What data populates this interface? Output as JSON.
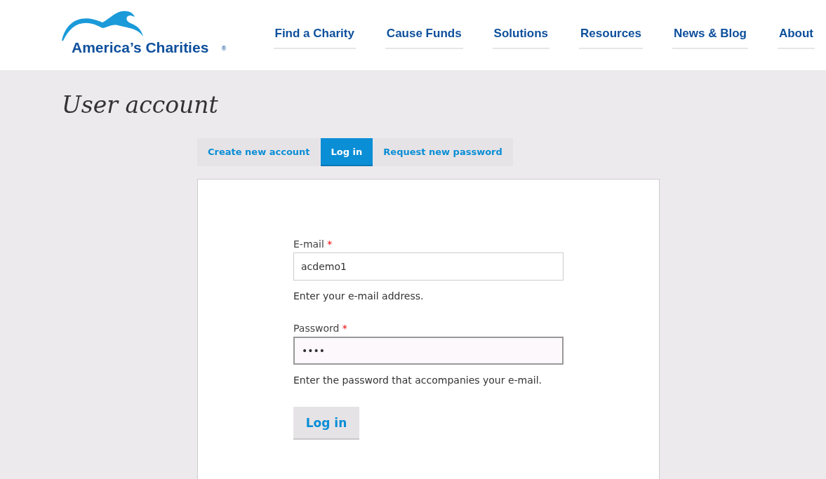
{
  "header": {
    "logo": {
      "name": "America’s Charities",
      "mark": "®"
    },
    "nav": [
      {
        "label": "Find a Charity"
      },
      {
        "label": "Cause Funds"
      },
      {
        "label": "Solutions"
      },
      {
        "label": "Resources"
      },
      {
        "label": "News & Blog"
      },
      {
        "label": "About"
      }
    ]
  },
  "page_title": "User account",
  "tabs": [
    {
      "label": "Create new account",
      "selected": false
    },
    {
      "label": "Log in",
      "selected": true
    },
    {
      "label": "Request new password",
      "selected": false
    }
  ],
  "form": {
    "fields": [
      {
        "label": "E-mail",
        "required": true,
        "required_mark": "*",
        "value": "acdemo1",
        "help": "Enter your e-mail address.",
        "focused": false
      },
      {
        "label": "Password",
        "required": true,
        "required_mark": "*",
        "value": "••••",
        "help": "Enter the password that accompanies your e-mail.",
        "focused": true
      }
    ],
    "submit": "Log in"
  }
}
